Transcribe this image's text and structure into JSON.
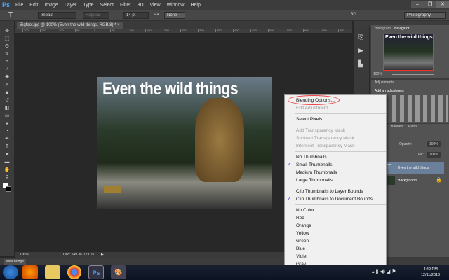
{
  "app": {
    "logo": "Ps",
    "menus": [
      "File",
      "Edit",
      "Image",
      "Layer",
      "Type",
      "Select",
      "Filter",
      "3D",
      "View",
      "Window",
      "Help"
    ],
    "window_buttons": [
      "–",
      "❐",
      "✕"
    ]
  },
  "options": {
    "tool_icon": "T",
    "font_family": "Impact",
    "font_style": "Regular",
    "font_size": "14 pt",
    "aa_label": "aa",
    "antialias": "None",
    "workspace": "Photography",
    "threed": "3D"
  },
  "document": {
    "tab_title": "Bigfoot.jpg @ 100% (Even the wild things, RGB/8) *",
    "close": "×",
    "ruler": [
      "200",
      "150",
      "100",
      "50",
      "0",
      "50",
      "100",
      "150",
      "200",
      "250",
      "300",
      "350",
      "400",
      "450",
      "500",
      "550",
      "600",
      "650",
      "700"
    ],
    "artwork_text": "Even the wild things",
    "zoom": "100%",
    "doc_info": "Doc: 549.3K/723.1K"
  },
  "bottom_panel": {
    "mini_bridge": "Mini Bridge"
  },
  "panels": {
    "histogram_tab": "Histogram",
    "navigator_tab": "Navigator",
    "nav_zoom": "100%",
    "adjustments_tab": "Adjustments",
    "add_adjustment": "Add an adjustment",
    "channels_tab": "Channels",
    "paths_tab": "Paths",
    "opacity_label": "Opacity:",
    "opacity": "100%",
    "fill_label": "Fill:",
    "fill": "100%",
    "layers": [
      {
        "name": "Even the wild things",
        "selected": true,
        "thumb": "T"
      },
      {
        "name": "Background",
        "selected": false,
        "locked": true
      }
    ],
    "layer_footer": "fx"
  },
  "context_menu": {
    "groups": [
      [
        {
          "label": "Blending Options...",
          "disabled": false
        },
        {
          "label": "Edit Adjustment...",
          "disabled": true
        }
      ],
      [
        {
          "label": "Select Pixels",
          "disabled": false
        }
      ],
      [
        {
          "label": "Add Transparency Mask",
          "disabled": true
        },
        {
          "label": "Subtract Transparency Mask",
          "disabled": true
        },
        {
          "label": "Intersect Transparency Mask",
          "disabled": true
        }
      ],
      [
        {
          "label": "No Thumbnails"
        },
        {
          "label": "Small Thumbnails",
          "checked": true
        },
        {
          "label": "Medium Thumbnails"
        },
        {
          "label": "Large Thumbnails"
        }
      ],
      [
        {
          "label": "Clip Thumbnails to Layer Bounds"
        },
        {
          "label": "Clip Thumbnails to Document Bounds",
          "checked": true
        }
      ],
      [
        {
          "label": "No Color"
        },
        {
          "label": "Red"
        },
        {
          "label": "Orange"
        },
        {
          "label": "Yellow"
        },
        {
          "label": "Green"
        },
        {
          "label": "Blue"
        },
        {
          "label": "Violet"
        },
        {
          "label": "Gray"
        }
      ]
    ],
    "check": "✓"
  },
  "taskbar": {
    "apps": [
      "start",
      "firefox",
      "explorer",
      "chrome",
      "photoshop",
      "paint"
    ],
    "ps_label": "Ps",
    "time": "4:49 PM",
    "date": "12/11/2016"
  },
  "colors": {
    "accent": "#4da3ff",
    "selected_layer": "#6a7f99",
    "annotation": "#e44444"
  }
}
